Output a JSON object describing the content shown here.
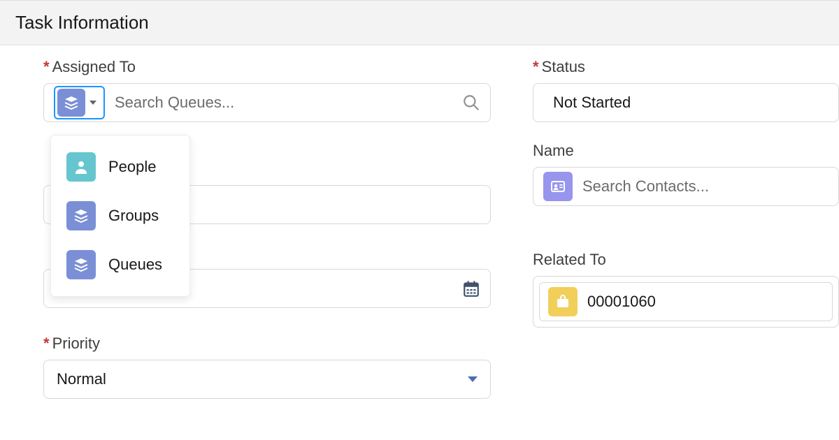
{
  "header": {
    "title": "Task Information"
  },
  "assigned_to": {
    "label": "Assigned To",
    "placeholder": "Search Queues...",
    "type_options": [
      {
        "key": "people",
        "label": "People"
      },
      {
        "key": "groups",
        "label": "Groups"
      },
      {
        "key": "queues",
        "label": "Queues"
      }
    ]
  },
  "status": {
    "label": "Status",
    "value": "Not Started"
  },
  "name": {
    "label": "Name",
    "placeholder": "Search Contacts..."
  },
  "related_to": {
    "label": "Related To",
    "value": "00001060"
  },
  "priority": {
    "label": "Priority",
    "value": "Normal"
  }
}
